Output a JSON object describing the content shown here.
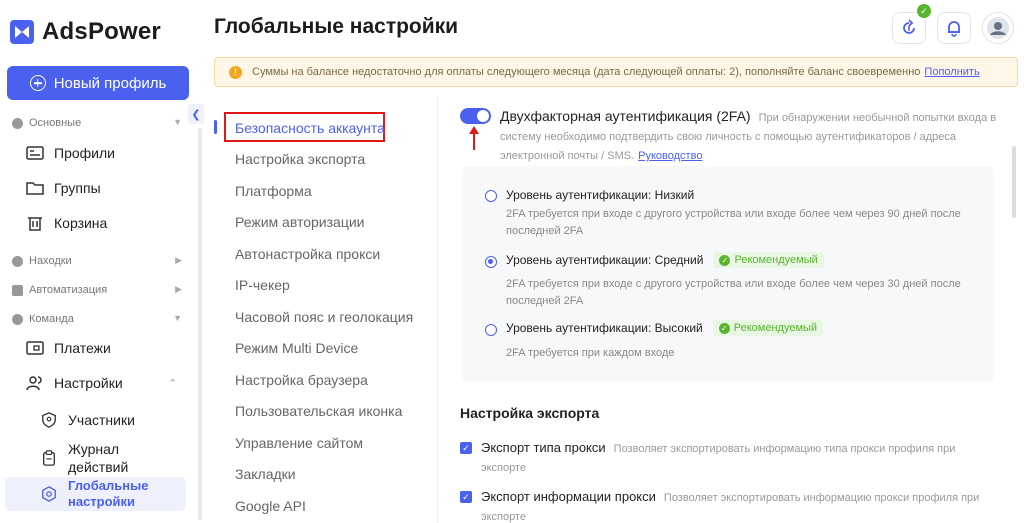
{
  "brand": {
    "name": "AdsPower",
    "color": "#4a61f0"
  },
  "sidebar": {
    "new_profile_label": "Новый профиль",
    "sections": {
      "basic": "Основные",
      "finds": "Находки",
      "automation": "Автоматизация",
      "team": "Команда"
    },
    "items": {
      "profiles": "Профили",
      "groups": "Группы",
      "trash": "Корзина",
      "payments": "Платежи",
      "settings": "Настройки",
      "members": "Участники",
      "journal": "Журнал действий",
      "global": "Глобальные настройки"
    }
  },
  "header": {
    "title": "Глобальные настройки"
  },
  "alert": {
    "text": "Суммы на балансе недостаточно для оплаты следующего месяца (дата следующей оплаты: 2), пополняйте баланс своевременно",
    "link": "Пополнить"
  },
  "menu": [
    "Безопасность аккаунта",
    "Настройка экспорта",
    "Платформа",
    "Режим авторизации",
    "Автонастройка прокси",
    "IP-чекер",
    "Часовой пояс и геолокация",
    "Режим Multi Device",
    "Настройка браузера",
    "Пользовательская иконка",
    "Управление сайтом",
    "Закладки",
    "Google API"
  ],
  "twofa": {
    "title": "Двухфакторная аутентификация (2FA)",
    "desc": "При обнаружении необычной попытки входа в систему необходимо подтвердить свою личность с помощью аутентификаторов / адреса электронной почты / SMS.",
    "link": "Руководство",
    "enabled": true
  },
  "levels": [
    {
      "title": "Уровень аутентификации: Низкий",
      "desc": "2FA требуется при входе с другого устройства или входе более чем через 90 дней после последней 2FA",
      "recommended": false,
      "checked": false
    },
    {
      "title": "Уровень аутентификации: Средний",
      "desc": "2FA требуется при входе с другого устройства или входе более чем через 30 дней после последней 2FA",
      "recommended": true,
      "checked": true
    },
    {
      "title": "Уровень аутентификации: Высокий",
      "desc": "2FA требуется при каждом входе",
      "recommended": true,
      "checked": false
    }
  ],
  "recommended_label": "Рекомендуемый",
  "export": {
    "title": "Настройка экспорта",
    "items": [
      {
        "title": "Экспорт типа прокси",
        "desc": "Позволяет экспортировать информацию типа прокси профиля при экспорте"
      },
      {
        "title": "Экспорт информации прокси",
        "desc": "Позволяет экспортировать информацию прокси профиля при экспорте"
      }
    ]
  }
}
